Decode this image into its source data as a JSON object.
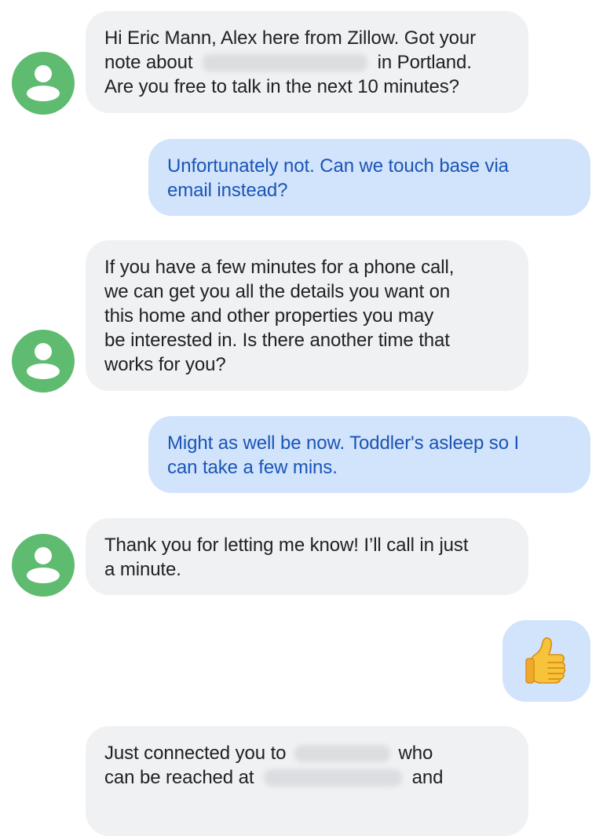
{
  "conversation": {
    "messages": [
      {
        "direction": "incoming",
        "lines": [
          "Hi Eric Mann, Alex here from Zillow. Got your",
          "note about",
          "in Portland.",
          "Are you free to talk in the next 10 minutes?"
        ]
      },
      {
        "direction": "outgoing",
        "lines": [
          "Unfortunately not. Can we touch base via",
          "email instead?"
        ]
      },
      {
        "direction": "incoming",
        "lines": [
          "If you have a few minutes for a phone call,",
          "we can get you all the details you want on",
          "this home and other properties you may",
          "be interested in. Is there another time that",
          "works for you?"
        ]
      },
      {
        "direction": "outgoing",
        "lines": [
          "Might as well be now. Toddler's asleep so I",
          "can take a few mins."
        ]
      },
      {
        "direction": "incoming",
        "lines": [
          "Thank you for letting me know! I’ll call in just",
          "a minute."
        ]
      },
      {
        "direction": "outgoing",
        "emoji": "thumbs-up"
      },
      {
        "direction": "incoming",
        "lines": [
          "Just connected you to",
          "who",
          "can be reached at",
          "and"
        ]
      }
    ]
  },
  "colors": {
    "avatar": "#5ebb6f",
    "incoming_bubble": "#f0f1f3",
    "outgoing_bubble": "#d2e3fc",
    "outgoing_text": "#1a55b5",
    "incoming_text": "#202124"
  },
  "icons": {
    "avatar": "person-icon",
    "emoji": "thumbs-up-icon"
  }
}
